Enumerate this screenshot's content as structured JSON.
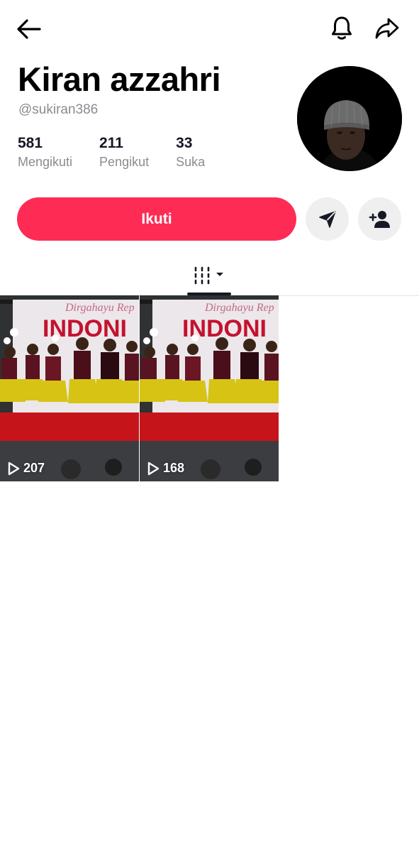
{
  "profile": {
    "display_name": "Kiran azzahri",
    "username": "@sukiran386",
    "stats": [
      {
        "value": "581",
        "label": "Mengikuti"
      },
      {
        "value": "211",
        "label": "Pengikut"
      },
      {
        "value": "33",
        "label": "Suka"
      }
    ]
  },
  "actions": {
    "follow_label": "Ikuti"
  },
  "videos": [
    {
      "views": "207",
      "overlay_text": "INDONI",
      "banner_text": "Dirgahayu Rep"
    },
    {
      "views": "168",
      "overlay_text": "INDONI",
      "banner_text": "Dirgahayu Rep"
    }
  ],
  "colors": {
    "accent": "#fe2c55",
    "text_primary": "#161823",
    "text_secondary": "#8a8b91",
    "button_gray": "#efefef"
  },
  "icons": {
    "back": "arrow-left",
    "notifications": "bell",
    "share": "share-arrow",
    "message": "paper-plane",
    "add_friend": "person-plus",
    "videos_tab": "grid-columns"
  }
}
